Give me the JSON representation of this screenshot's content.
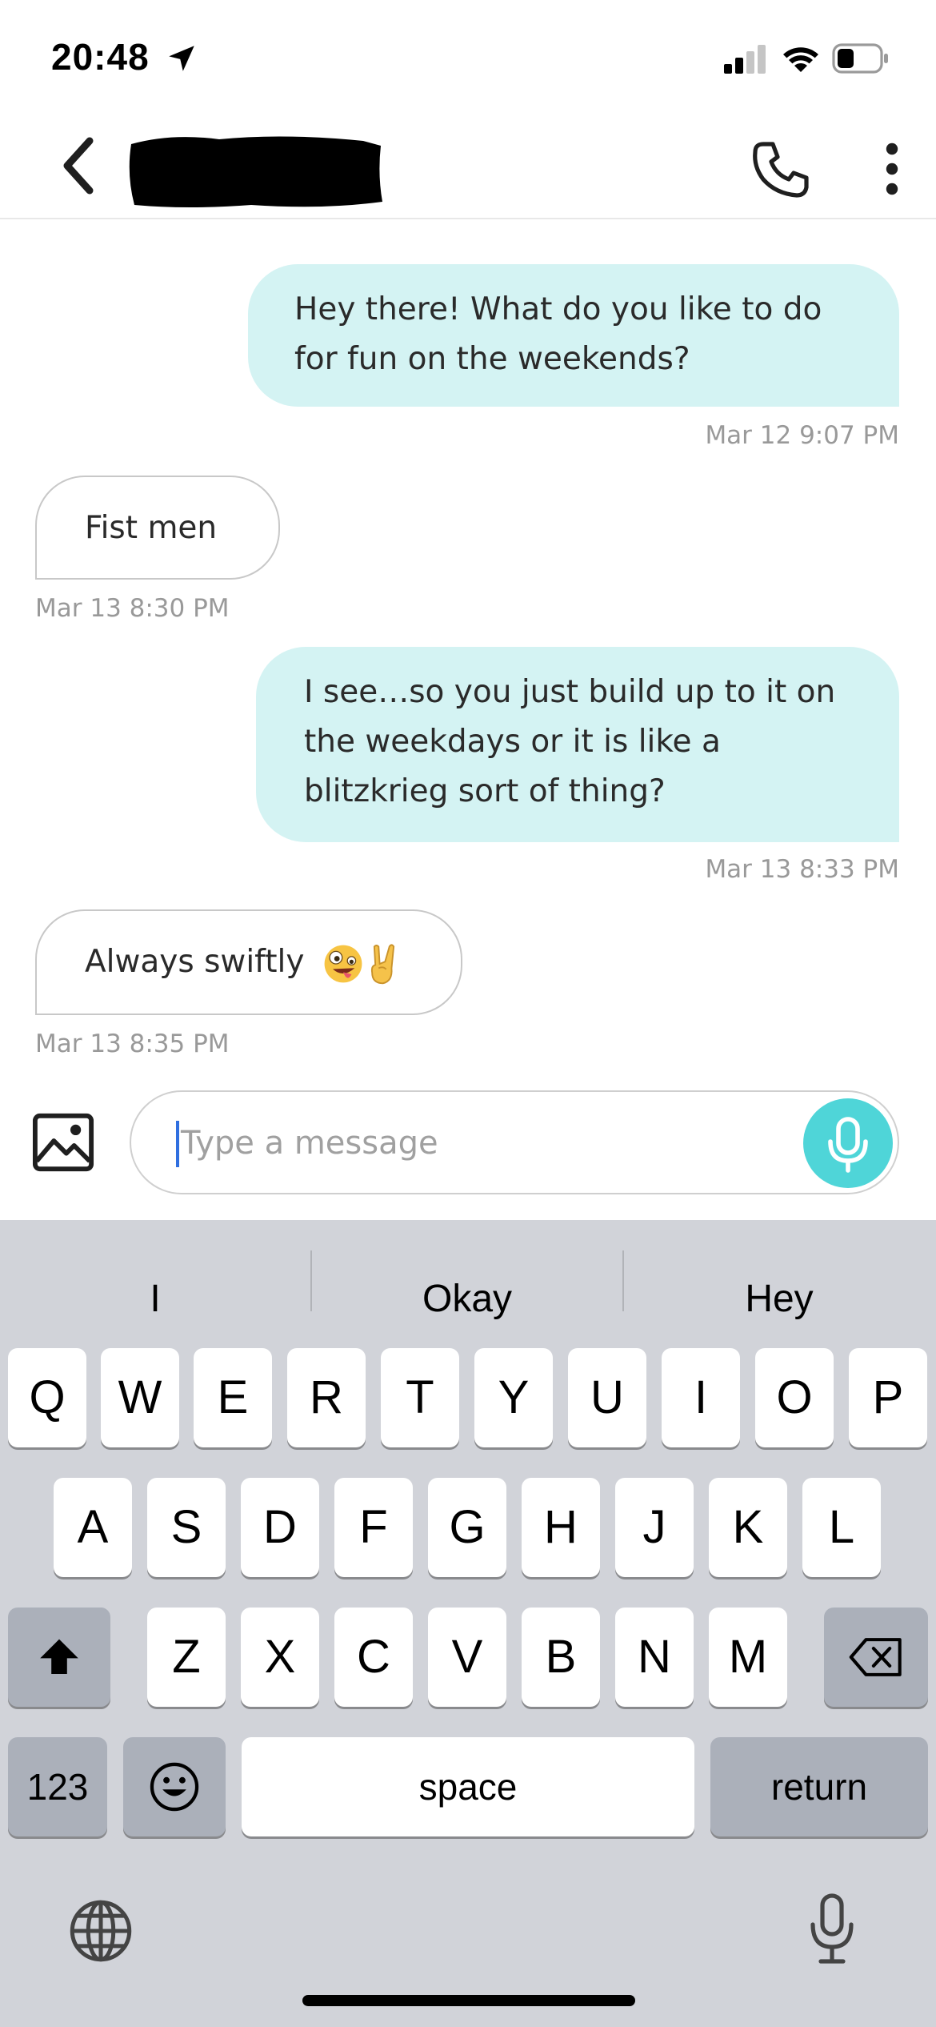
{
  "status_bar": {
    "time": "20:48",
    "location_icon": "location-arrow-icon",
    "signal_icon": "cellular-signal-icon",
    "wifi_icon": "wifi-icon",
    "battery_icon": "battery-icon",
    "signal_bars_active": 2,
    "signal_bars_total": 4,
    "battery_level": 0.35
  },
  "header": {
    "back_icon": "chevron-left-icon",
    "call_icon": "phone-icon",
    "more_icon": "more-vertical-icon"
  },
  "messages": [
    {
      "direction": "outgoing",
      "lines": [
        "Hey there! What do you like to do",
        "for fun on the weekends?"
      ],
      "timestamp": "Mar 12 9:07 PM"
    },
    {
      "direction": "incoming",
      "text": "Fist men",
      "timestamp": "Mar 13 8:30 PM"
    },
    {
      "direction": "outgoing",
      "lines": [
        "I see…so you just build up to it on",
        "the weekdays or it is like a",
        "blitzkrieg sort of thing?"
      ],
      "timestamp": "Mar 13 8:33 PM"
    },
    {
      "direction": "incoming",
      "text": "Always swiftly",
      "emojis": [
        "zany-face-emoji",
        "sign-of-horns-emoji"
      ],
      "timestamp": "Mar 13 8:35 PM"
    }
  ],
  "composer": {
    "image_icon": "image-icon",
    "placeholder": "Type a message",
    "mic_icon": "microphone-icon"
  },
  "keyboard": {
    "suggestions": [
      "I",
      "Okay",
      "Hey"
    ],
    "row1": [
      "Q",
      "W",
      "E",
      "R",
      "T",
      "Y",
      "U",
      "I",
      "O",
      "P"
    ],
    "row2": [
      "A",
      "S",
      "D",
      "F",
      "G",
      "H",
      "J",
      "K",
      "L"
    ],
    "row3": [
      "Z",
      "X",
      "C",
      "V",
      "B",
      "N",
      "M"
    ],
    "shift_icon": "shift-arrow-icon",
    "delete_icon": "backspace-icon",
    "numbers_label": "123",
    "emoji_icon": "emoji-smiley-icon",
    "space_label": "space",
    "return_label": "return",
    "globe_icon": "globe-icon",
    "dictation_icon": "microphone-icon"
  },
  "colors": {
    "outgoing_bubble": "#d4f3f3",
    "accent": "#4fd5d8",
    "timestamp": "#999999",
    "keyboard_bg": "#d1d3d9",
    "cursor": "#2f6fe0"
  }
}
